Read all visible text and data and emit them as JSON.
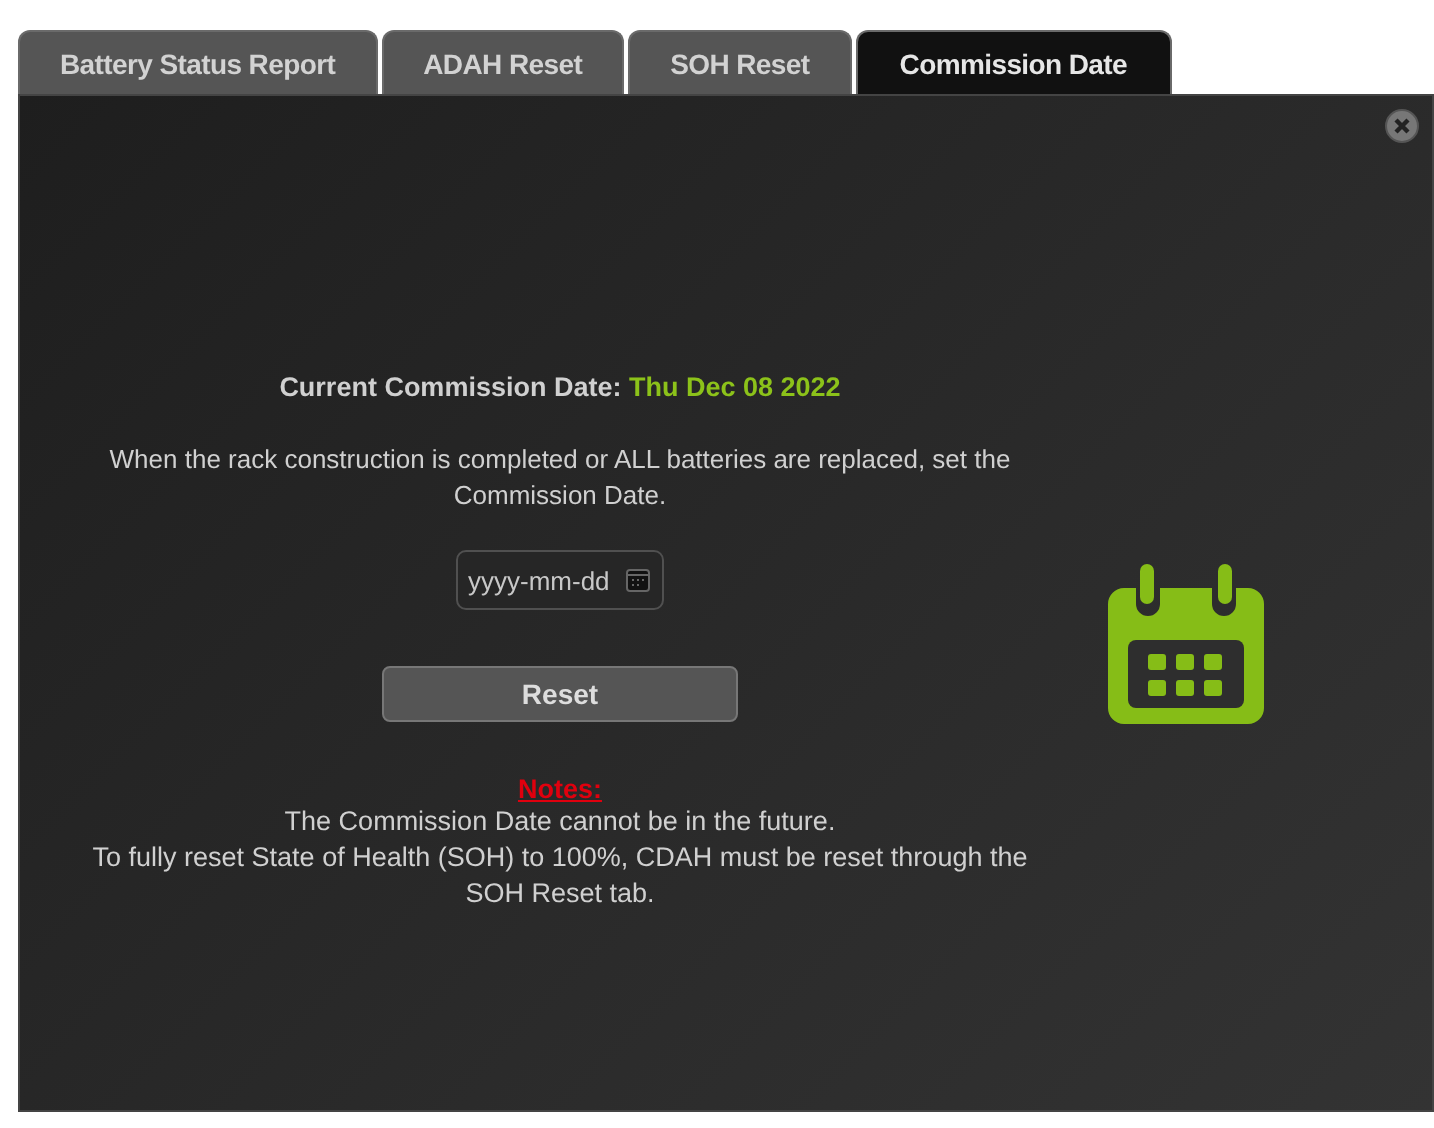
{
  "tabs": [
    {
      "label": "Battery Status Report",
      "selected": false
    },
    {
      "label": "ADAH Reset",
      "selected": false
    },
    {
      "label": "SOH Reset",
      "selected": false
    },
    {
      "label": "Commission Date",
      "selected": true
    }
  ],
  "current": {
    "label": "Current Commission Date:",
    "value": "Thu Dec 08 2022"
  },
  "instruction": "When the rack construction is completed or ALL batteries are replaced, set the Commission Date.",
  "date_field": {
    "placeholder": "yyyy-mm-dd"
  },
  "reset_button": "Reset",
  "notes": {
    "title": "Notes:",
    "lines": [
      "The Commission Date cannot be in the future.",
      "To fully reset State of Health (SOH) to 100%, CDAH must be reset through the SOH Reset tab."
    ]
  }
}
